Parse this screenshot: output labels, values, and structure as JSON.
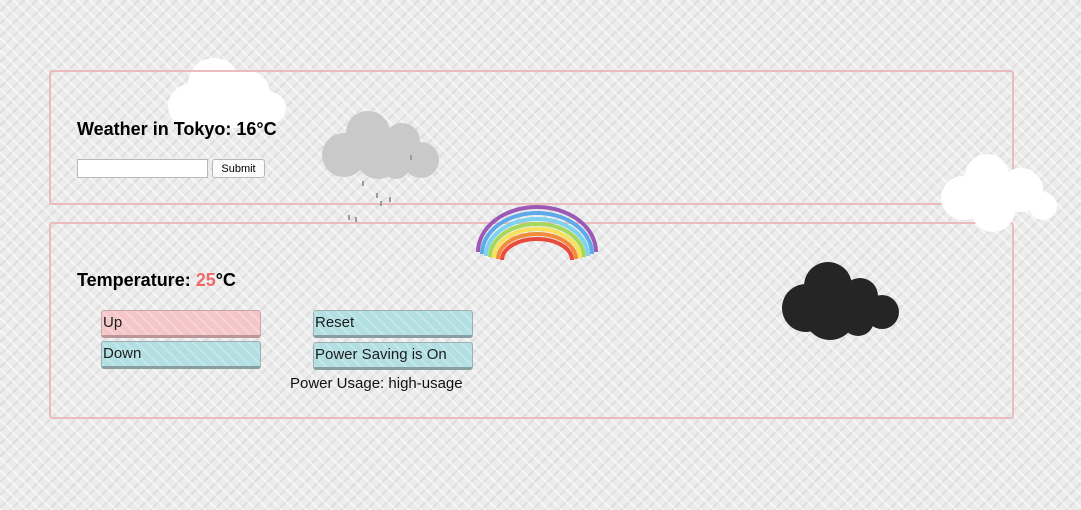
{
  "weather": {
    "heading_prefix": "Weather in ",
    "city": "Tokyo",
    "heading_sep": ": ",
    "temperature": "16",
    "unit": "°C",
    "input_value": "",
    "input_placeholder": "",
    "submit_label": "Submit"
  },
  "thermostat": {
    "heading_label": "Temperature: ",
    "temperature": "25",
    "unit": "°C",
    "temperature_color": "#f06a6a",
    "up_label": "Up",
    "down_label": "Down",
    "reset_label": "Reset",
    "power_saving_label": "Power Saving is On",
    "power_usage_label": "Power Usage: ",
    "power_usage_value": "high-usage"
  },
  "decorations": {
    "icons": [
      "white-cloud-icon",
      "rain-cloud-icon",
      "rainbow-icon",
      "dark-cloud-icon"
    ]
  },
  "colors": {
    "panel_border": "#ecbcbc",
    "up_button": "#f5c6c8",
    "button_cyan": "#b2dfe2",
    "dark_cloud": "#252525"
  }
}
